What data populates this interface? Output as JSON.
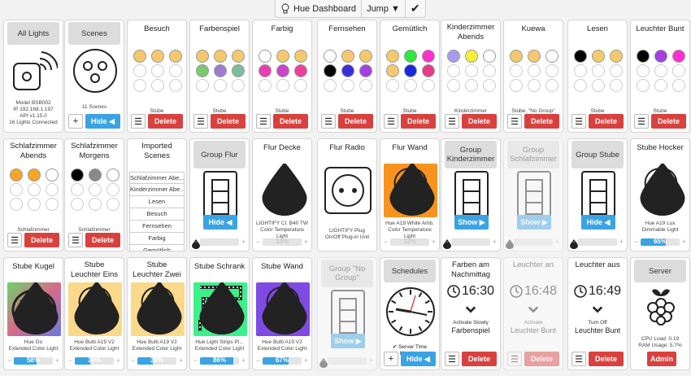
{
  "topbar": {
    "title": "Hue Dashboard",
    "jump": "Jump ▼",
    "check": "✔"
  },
  "labels": {
    "delete": "Delete",
    "hide": "Hide ◀",
    "show": "Show ▶",
    "admin": "Admin",
    "plus": "+",
    "minus": "−",
    "list": "☰"
  },
  "row1": [
    {
      "title": "All Lights",
      "caption": "Model BSB002\nIP 192.168.1.197\nAPI v1.15.0\n16 Lights Connected"
    },
    {
      "title": "Scenes",
      "caption": "11 Scenes"
    },
    {
      "title": "Besuch",
      "caption": "Stube"
    },
    {
      "title": "Farbenspiel",
      "caption": "Stube"
    },
    {
      "title": "Farbig",
      "caption": "Stube"
    },
    {
      "title": "Fernsehen",
      "caption": "Stube"
    },
    {
      "title": "Gemütlich",
      "caption": "Stube"
    },
    {
      "title": "Kinderzimmer Abends",
      "caption": "Kinderzimmer"
    },
    {
      "title": "Kuewa",
      "caption": "Stube, \"No Group\""
    },
    {
      "title": "Lesen",
      "caption": "Stube"
    },
    {
      "title": "Leuchter Bunt",
      "caption": "Stube"
    }
  ],
  "row2": [
    {
      "title": "Schlafzimmer Abends",
      "caption": "Schlafzimmer"
    },
    {
      "title": "Schlafzimmer Morgens",
      "caption": "Schlafzimmer"
    },
    {
      "title": "Imported Scenes",
      "items": [
        "Schlafzimmer Abe...",
        "Kinderzimmer Abe...",
        "Lesen",
        "Besuch",
        "Fernsehen",
        "Farbig",
        "Gemütlich"
      ]
    },
    {
      "title": "Group Flur"
    },
    {
      "title": "Flur Decke",
      "caption": "LIGHTIFY Cl. B40 TW\nColor Temperature Light",
      "value": "13%"
    },
    {
      "title": "Flur Radio",
      "caption": "LIGHTIFY Plug\nOn/Off Plug-in Unit"
    },
    {
      "title": "Flur Wand",
      "caption": "Hue A19 White Amb.\nColor Temperature Light",
      "value": "12%"
    },
    {
      "title": "Group Kinderzimmer"
    },
    {
      "title": "Group Schlafzimmer"
    },
    {
      "title": "Group Stube"
    },
    {
      "title": "Stube Hocker",
      "caption": "Hue A19 Lux\nDimmable Light",
      "value": "65%"
    }
  ],
  "row3": [
    {
      "title": "Stube Kugel",
      "caption": "Hue Go\nExtended Color Light",
      "value": "58%"
    },
    {
      "title": "Stube Leuchter Eins",
      "caption": "Hue Bulb A19 V2\nExtended Color Light",
      "value": "39%"
    },
    {
      "title": "Stube Leuchter Zwei",
      "caption": "Hue Bulb A19 V2\nExtended Color Light",
      "value": "39%"
    },
    {
      "title": "Stube Schrank",
      "caption": "Hue Light Strips Pl...\nExtended Color Light",
      "value": "86%"
    },
    {
      "title": "Stube Wand",
      "caption": "Hue Bulb A19 V2\nExtended Color Light",
      "value": "67%"
    },
    {
      "title": "Group \"No Group\""
    },
    {
      "title": "Schedules",
      "caption": "✔ Server Time Matches"
    },
    {
      "title": "Farben am Nachmittag",
      "time": "16:30",
      "action": "Activate Slowly",
      "target": "Farbenspiel"
    },
    {
      "title": "Leuchter an",
      "time": "16:48",
      "action": "Activate",
      "target": "Leuchter Bunt"
    },
    {
      "title": "Leuchter aus",
      "time": "16:49",
      "action": "Turn Off",
      "target": "Leuchter Bunt"
    },
    {
      "title": "Server",
      "caption": "CPU Load: 0.19\nRAM Usage: 5.7%"
    }
  ],
  "colors": {
    "besuch": [
      "#f6c86e",
      "#f6c86e",
      "#f6c86e"
    ],
    "farbenspiel": [
      "#f6c86e",
      "#f6c86e",
      "#f6c86e",
      "#7bc96f",
      "#a07ad0",
      "#7bbf9a"
    ],
    "farbig": [
      "#fff",
      "#f6c86e",
      "#f6c86e",
      "#e83fb0",
      "#cc44cc",
      "#ee3f9f"
    ],
    "fernsehen": [
      "#fff",
      "#f6c86e",
      "#f6c86e",
      "#000",
      "#3a2fd8",
      "#a63fe0"
    ],
    "gemutlich": [
      "#f6c86e",
      "#2ee83a",
      "#ff2fd0",
      "#f6c86e",
      "#1a28e0",
      "#e83a8a"
    ],
    "kinderzimmer": [
      "#a89bf0",
      "#f7ef3a",
      "#fff"
    ],
    "kuewa": [
      "#f6c86e",
      "#f6c86e",
      "#fff"
    ],
    "lesen": [
      "#000",
      "#f6c86e",
      "#f6c86e"
    ],
    "leuchterbunt": [
      "#000",
      "#a63fe0",
      "#ff2fd0"
    ],
    "sza": [
      "#f7a428",
      "#f7a428",
      "#fff"
    ],
    "szm": [
      "#000",
      "#888",
      "#fff"
    ],
    "accent": "#3aa3e3",
    "danger": "#d9413e"
  }
}
